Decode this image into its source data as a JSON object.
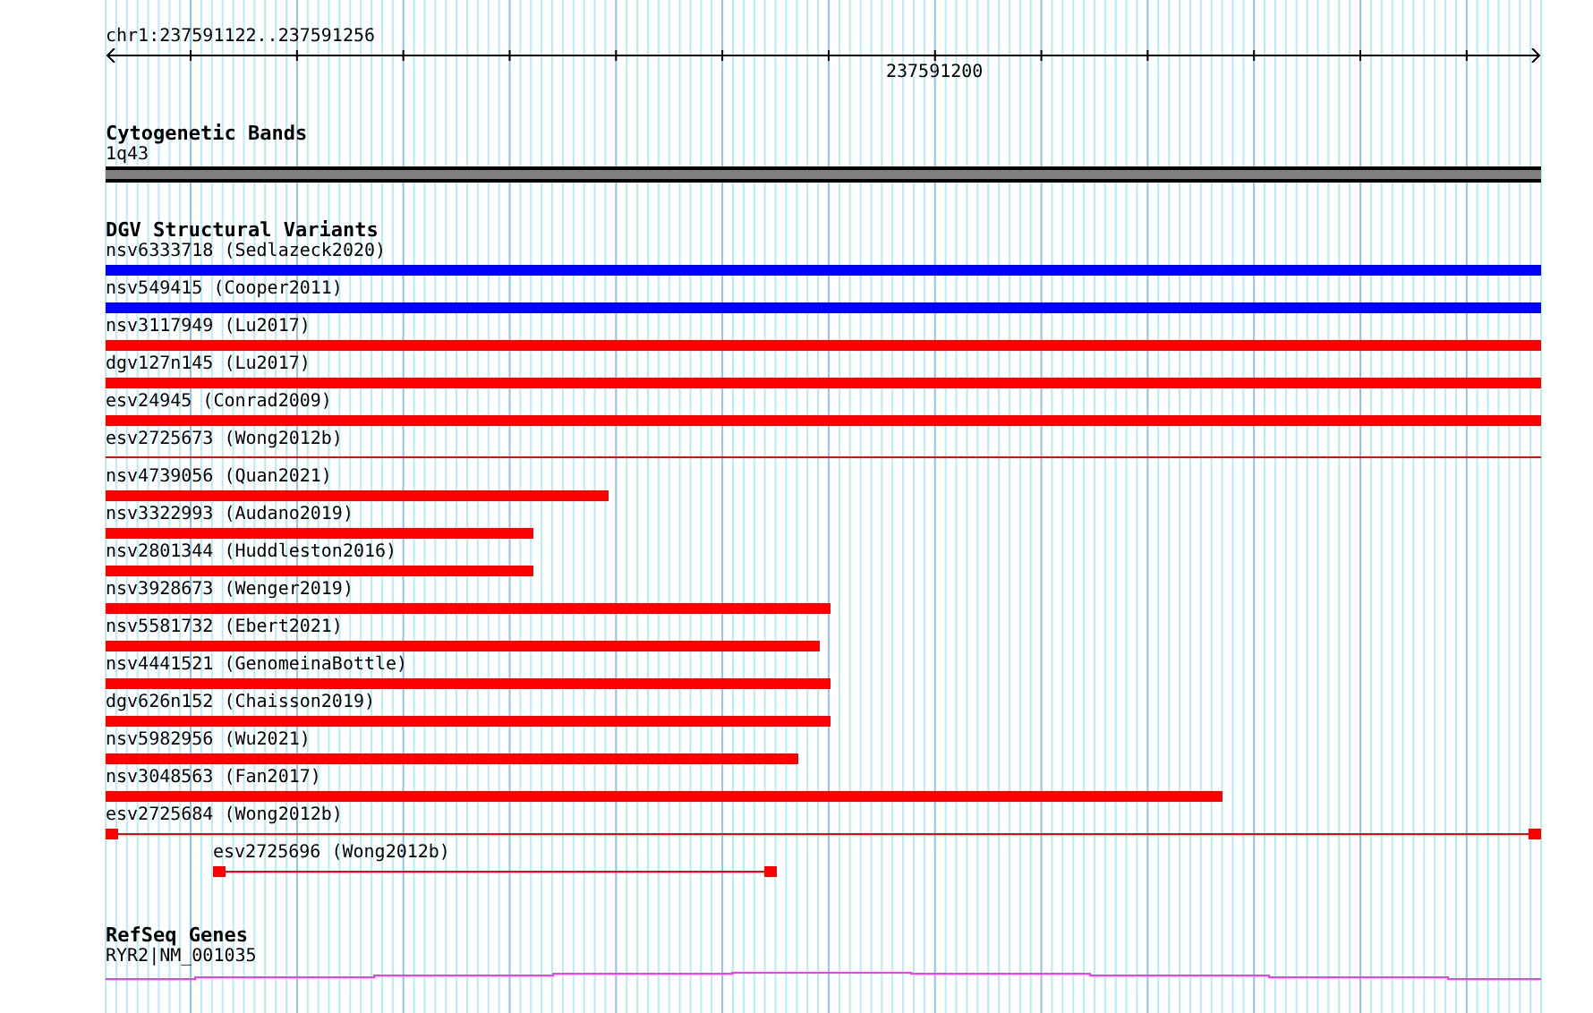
{
  "ruler": {
    "location": "chr1:237591122..237591256",
    "tick_label": "237591200"
  },
  "tracks": [
    {
      "kind": "cytoband",
      "title": "Cytogenetic Bands",
      "features": [
        {
          "label": "1q43"
        }
      ]
    },
    {
      "kind": "variants",
      "title": "DGV Structural Variants",
      "features": [
        {
          "label": "nsv6333718 (Sedlazeck2020)",
          "kind": "bar",
          "color": "#0000ff"
        },
        {
          "label": "nsv549415 (Cooper2011)",
          "kind": "bar",
          "color": "#0000ff"
        },
        {
          "label": "nsv3117949 (Lu2017)",
          "kind": "bar",
          "color": "#ff0000"
        },
        {
          "label": "dgv127n145 (Lu2017)",
          "kind": "bar",
          "color": "#ff0000"
        },
        {
          "label": "esv24945 (Conrad2009)",
          "kind": "bar",
          "color": "#ff0000"
        },
        {
          "label": "esv2725673 (Wong2012b)",
          "kind": "line",
          "color": "#ff0000"
        },
        {
          "label": "nsv4739056 (Quan2021)",
          "kind": "bar",
          "color": "#ff0000"
        },
        {
          "label": "nsv3322993 (Audano2019)",
          "kind": "bar",
          "color": "#ff0000"
        },
        {
          "label": "nsv2801344 (Huddleston2016)",
          "kind": "bar",
          "color": "#ff0000"
        },
        {
          "label": "nsv3928673 (Wenger2019)",
          "kind": "bar",
          "color": "#ff0000"
        },
        {
          "label": "nsv5581732 (Ebert2021)",
          "kind": "bar",
          "color": "#ff0000"
        },
        {
          "label": "nsv4441521 (GenomeinaBottle)",
          "kind": "bar",
          "color": "#ff0000"
        },
        {
          "label": "dgv626n152 (Chaisson2019)",
          "kind": "bar",
          "color": "#ff0000"
        },
        {
          "label": "nsv5982956 (Wu2021)",
          "kind": "bar",
          "color": "#ff0000"
        },
        {
          "label": "nsv3048563 (Fan2017)",
          "kind": "bar",
          "color": "#ff0000"
        },
        {
          "label": "esv2725684 (Wong2012b)",
          "kind": "split",
          "color": "#ff0000"
        },
        {
          "label": "esv2725696 (Wong2012b)",
          "kind": "split",
          "color": "#ff0000"
        }
      ]
    },
    {
      "kind": "gene",
      "title": "RefSeq Genes",
      "features": [
        {
          "label": "RYR2|NM_001035"
        }
      ]
    }
  ]
}
